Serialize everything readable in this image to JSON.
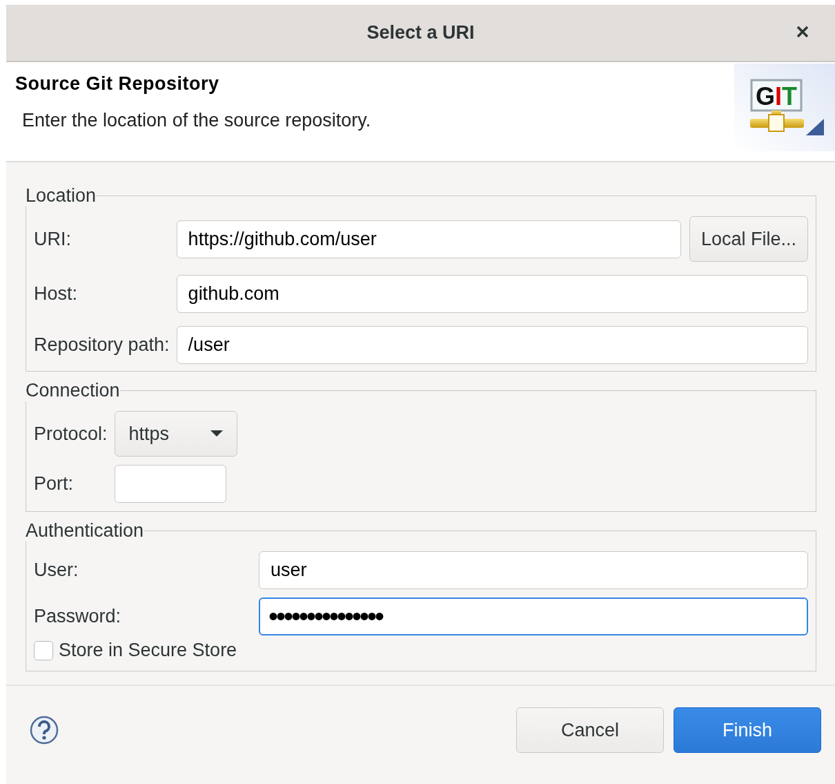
{
  "window": {
    "title": "Select a URI"
  },
  "header": {
    "title": "Source Git Repository",
    "description": "Enter the location of the source repository.",
    "logo_text": "GIT"
  },
  "groups": [
    {
      "kind": "location",
      "legend": "Location",
      "rows": [
        {
          "kind": "text",
          "label": "URI:",
          "value": "https://github.com/user",
          "focused": false,
          "button": "Local File..."
        },
        {
          "kind": "text",
          "label": "Host:",
          "value": "github.com",
          "focused": false
        },
        {
          "kind": "text",
          "label": "Repository path:",
          "value": "/user",
          "focused": false
        }
      ]
    },
    {
      "kind": "connection",
      "legend": "Connection",
      "rows": [
        {
          "kind": "combo",
          "label": "Protocol:",
          "value": "https"
        },
        {
          "kind": "short",
          "label": "Port:",
          "focused": false
        }
      ]
    },
    {
      "kind": "authentication",
      "legend": "Authentication",
      "rows": [
        {
          "kind": "text",
          "label": "User:",
          "value": "user",
          "focused": false
        },
        {
          "kind": "password",
          "label": "Password:",
          "value": "•••••••••••••••",
          "focused": true
        },
        {
          "kind": "checkbox",
          "label": "Store in Secure Store",
          "checked": false
        }
      ]
    }
  ],
  "buttons": [
    {
      "label": "Cancel",
      "primary": false
    },
    {
      "label": "Finish",
      "primary": true
    }
  ]
}
